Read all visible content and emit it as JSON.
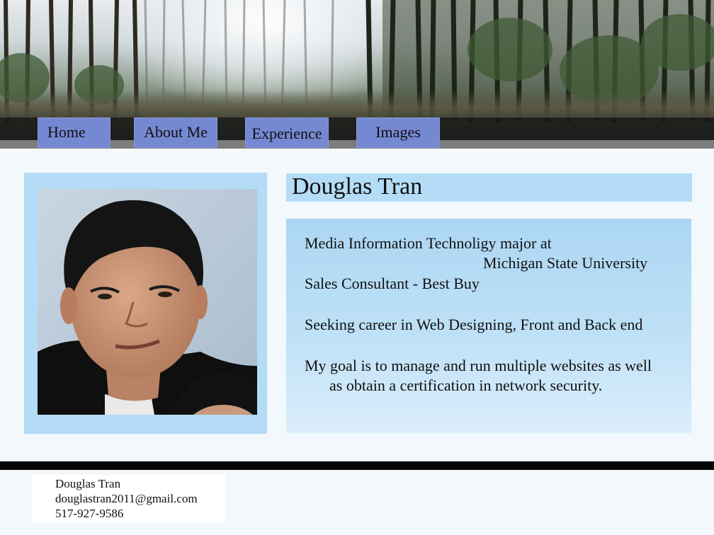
{
  "nav": {
    "tabs": [
      {
        "label": "Home"
      },
      {
        "label": "About Me"
      },
      {
        "label": "Experience"
      },
      {
        "label": "Images"
      }
    ]
  },
  "profile": {
    "name": "Douglas Tran",
    "lines": [
      "Media Information Technoligy major at",
      "Michigan State University",
      "Sales Consultant - Best Buy",
      "Seeking career in Web Designing, Front and Back end",
      "My goal is to manage and run multiple websites as well",
      "as obtain a certification in network security."
    ]
  },
  "footer": {
    "name": "Douglas Tran",
    "email": "douglastran2011@gmail.com",
    "phone": "517-927-9586"
  },
  "colors": {
    "nav_tab": "#7588d2",
    "panel": "#b4dcf6",
    "page_bg": "#f3f8fc",
    "footer_rule": "#050505"
  }
}
